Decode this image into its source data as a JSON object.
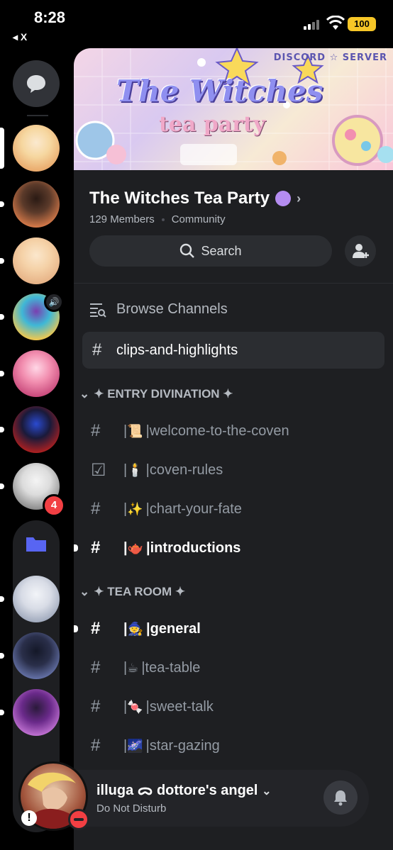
{
  "status_bar": {
    "time": "8:28",
    "back_label": "◂ X",
    "battery": "100"
  },
  "colors": {
    "accent": "#5865f2",
    "badge_red": "#f23f43",
    "panel_bg": "#1e1f22",
    "battery_yellow": "#f6c627"
  },
  "rail": {
    "servers": [
      {
        "name": "server-1",
        "colors": [
          "#f6d7a0",
          "#e9a86a",
          "#fbe9cf"
        ],
        "selected": true
      },
      {
        "name": "server-2",
        "colors": [
          "#5b3a2a",
          "#d87b4a",
          "#2a1a14"
        ]
      },
      {
        "name": "server-3",
        "colors": [
          "#f5d2a8",
          "#e6b185",
          "#fbe7cc"
        ]
      },
      {
        "name": "server-4",
        "colors": [
          "#3fb8d6",
          "#f6c84a",
          "#7a3fb0"
        ],
        "voice": true
      },
      {
        "name": "server-5",
        "colors": [
          "#f28fb0",
          "#c7487a",
          "#ffd7e6"
        ]
      },
      {
        "name": "server-6",
        "colors": [
          "#1a1a3a",
          "#b02020",
          "#2a4ad0"
        ]
      },
      {
        "name": "server-7",
        "colors": [
          "#dcdcdc",
          "#8a8a8a",
          "#f4f4f4"
        ],
        "badge": "4"
      }
    ],
    "folder_servers": [
      {
        "name": "folder-server-1",
        "colors": [
          "#d8dce6",
          "#9aa4b8",
          "#f2f4f8"
        ]
      },
      {
        "name": "folder-server-2",
        "colors": [
          "#2a2f4a",
          "#6a78b0",
          "#141828"
        ]
      },
      {
        "name": "folder-server-3",
        "colors": [
          "#6a2a8a",
          "#c878d8",
          "#2a1a3a"
        ]
      }
    ]
  },
  "banner": {
    "tag": "DISCORD ☆ SERVER",
    "title": "The Witches",
    "subtitle": "tea party"
  },
  "server": {
    "name": "The Witches Tea Party",
    "members": "129 Members",
    "type": "Community",
    "search_label": "Search"
  },
  "channels": {
    "browse_label": "Browse Channels",
    "active": "clips-and-highlights",
    "categories": [
      {
        "label": "✦ ENTRY DIVINATION ✦",
        "items": [
          {
            "icon": "#",
            "emoji": "📜",
            "name": "welcome-to-the-coven",
            "unread": false
          },
          {
            "icon": "☑",
            "emoji": "🕯️",
            "name": "coven-rules",
            "unread": false
          },
          {
            "icon": "#",
            "emoji": "✨",
            "name": "chart-your-fate",
            "unread": false
          },
          {
            "icon": "#",
            "emoji": "🫖",
            "name": "introductions",
            "unread": true
          }
        ]
      },
      {
        "label": "✦ TEA ROOM ✦",
        "items": [
          {
            "icon": "#",
            "emoji": "🧙",
            "name": "general",
            "unread": true
          },
          {
            "icon": "#",
            "emoji": "☕",
            "name": "tea-table",
            "unread": false
          },
          {
            "icon": "#",
            "emoji": "🍬",
            "name": "sweet-talk",
            "unread": false
          },
          {
            "icon": "#",
            "emoji": "🌌",
            "name": "star-gazing",
            "unread": false
          }
        ]
      }
    ]
  },
  "user": {
    "name": "illuga ᯅ dottore's angel",
    "status": "Do Not Disturb"
  }
}
